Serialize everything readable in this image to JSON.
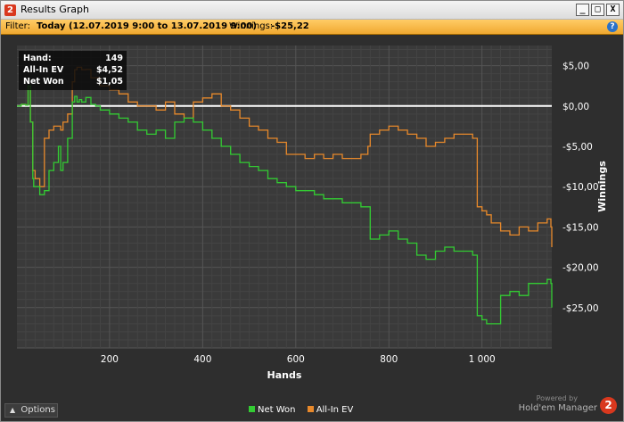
{
  "window": {
    "title": "Results Graph",
    "icon_label": "2",
    "buttons": {
      "minimize": "_",
      "maximize": "□",
      "close": "X"
    }
  },
  "filter": {
    "label": "Filter:",
    "value": "Today (12.07.2019 9:00 to 13.07.2019 9:00)",
    "winnings_label": "Winnings:",
    "winnings_value": "-$25,22"
  },
  "tooltip": {
    "rows": [
      {
        "label": "Hand:",
        "value": "149"
      },
      {
        "label": "All-In EV",
        "value": "$4,52"
      },
      {
        "label": "Net Won",
        "value": "$1,05"
      }
    ]
  },
  "bottom": {
    "options_label": "Options",
    "legend": [
      {
        "name": "Net Won",
        "color": "#33cc33"
      },
      {
        "name": "All-In EV",
        "color": "#e8892b"
      }
    ],
    "powered_by": "Powered by",
    "brand": "Hold'em Manager",
    "brand_logo": "2"
  },
  "chart_data": {
    "type": "line",
    "xlabel": "Hands",
    "ylabel": "Winnings",
    "xlim": [
      1,
      1150
    ],
    "ylim": [
      -30,
      7.5
    ],
    "xticks": [
      200,
      400,
      600,
      800,
      1000
    ],
    "xtick_labels": [
      "200",
      "400",
      "600",
      "800",
      "1 000"
    ],
    "yticks": [
      5,
      0,
      -5,
      -10,
      -15,
      -20,
      -25
    ],
    "ytick_labels": [
      "$5,00",
      "$0,00",
      "-$5,00",
      "-$10,00",
      "-$15,00",
      "-$20,00",
      "-$25,00"
    ],
    "zero_line": 0,
    "grid": true,
    "series": [
      {
        "name": "Net Won",
        "color": "#33cc33",
        "x": [
          1,
          10,
          20,
          25,
          30,
          35,
          37,
          40,
          50,
          60,
          70,
          80,
          90,
          95,
          100,
          110,
          120,
          125,
          130,
          135,
          140,
          149,
          160,
          170,
          180,
          200,
          220,
          240,
          260,
          280,
          300,
          320,
          340,
          360,
          380,
          400,
          420,
          440,
          460,
          480,
          500,
          520,
          540,
          560,
          580,
          600,
          620,
          640,
          660,
          680,
          700,
          720,
          740,
          755,
          760,
          780,
          800,
          820,
          840,
          860,
          880,
          900,
          920,
          940,
          960,
          980,
          990,
          1000,
          1010,
          1020,
          1040,
          1060,
          1080,
          1100,
          1120,
          1140,
          1148,
          1150
        ],
        "y": [
          0,
          0.2,
          0.1,
          2.5,
          -2,
          -9,
          -10,
          -10,
          -11,
          -10.5,
          -8,
          -7,
          -5,
          -8,
          -7,
          -4,
          0.5,
          1.2,
          0.5,
          0.8,
          0.5,
          1.05,
          0.2,
          0,
          -0.5,
          -1,
          -1.5,
          -2,
          -3,
          -3.5,
          -3,
          -4,
          -2,
          -1.5,
          -2,
          -3,
          -4,
          -5,
          -6,
          -7,
          -7.5,
          -8,
          -9,
          -9.5,
          -10,
          -10.5,
          -10.5,
          -11,
          -11.5,
          -11.5,
          -12,
          -12,
          -12.5,
          -12.5,
          -16.5,
          -16,
          -15.5,
          -16.5,
          -17,
          -18.5,
          -19,
          -18,
          -17.5,
          -18,
          -18,
          -18.5,
          -26,
          -26.5,
          -27,
          -27,
          -23.5,
          -23,
          -23.5,
          -22,
          -22,
          -21.5,
          -22,
          -25
        ]
      },
      {
        "name": "All-In EV",
        "color": "#e8892b",
        "x": [
          1,
          10,
          20,
          25,
          30,
          35,
          40,
          50,
          60,
          70,
          80,
          90,
          95,
          100,
          110,
          120,
          125,
          130,
          140,
          149,
          160,
          180,
          200,
          220,
          240,
          260,
          280,
          300,
          320,
          340,
          360,
          380,
          400,
          420,
          440,
          460,
          480,
          500,
          520,
          540,
          560,
          580,
          600,
          620,
          640,
          660,
          680,
          700,
          720,
          740,
          755,
          760,
          780,
          800,
          820,
          840,
          860,
          880,
          900,
          920,
          940,
          960,
          980,
          990,
          1000,
          1010,
          1020,
          1040,
          1060,
          1080,
          1100,
          1120,
          1140,
          1148,
          1150
        ],
        "y": [
          0,
          0.2,
          0.1,
          2.5,
          -2,
          -8,
          -9,
          -10,
          -4,
          -3,
          -2.5,
          -2.5,
          -3,
          -2,
          -1,
          3,
          4.5,
          4.8,
          4.5,
          4.52,
          3.5,
          2.5,
          2,
          1.5,
          0.5,
          0,
          0,
          -0.5,
          0.5,
          -1,
          -1.5,
          0.5,
          1,
          1.5,
          0,
          -0.5,
          -1.5,
          -2.5,
          -3,
          -4,
          -4.5,
          -6,
          -6,
          -6.5,
          -6,
          -6.5,
          -6,
          -6.5,
          -6.5,
          -6,
          -5,
          -3.5,
          -3,
          -2.5,
          -3,
          -3.5,
          -4,
          -5,
          -4.5,
          -4,
          -3.5,
          -3.5,
          -4,
          -12.5,
          -13,
          -13.5,
          -14.5,
          -15.5,
          -16,
          -15,
          -15.5,
          -14.5,
          -14,
          -15,
          -17.5
        ]
      }
    ]
  }
}
